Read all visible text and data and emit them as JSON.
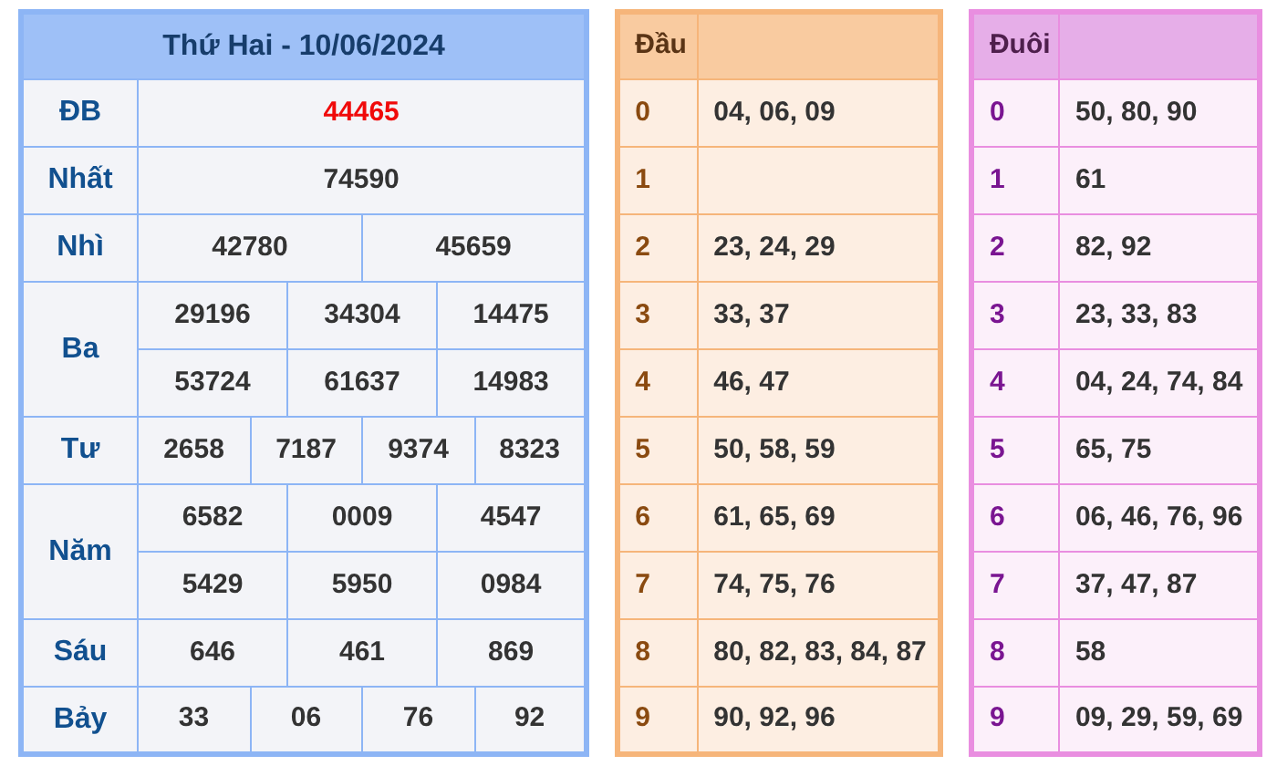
{
  "results": {
    "title": "Thứ Hai - 10/06/2024",
    "prizes": [
      {
        "label": "ĐB",
        "highlight": true,
        "rows": [
          [
            "44465"
          ]
        ]
      },
      {
        "label": "Nhất",
        "highlight": false,
        "rows": [
          [
            "74590"
          ]
        ]
      },
      {
        "label": "Nhì",
        "highlight": false,
        "rows": [
          [
            "42780",
            "45659"
          ]
        ]
      },
      {
        "label": "Ba",
        "highlight": false,
        "rows": [
          [
            "29196",
            "34304",
            "14475"
          ],
          [
            "53724",
            "61637",
            "14983"
          ]
        ]
      },
      {
        "label": "Tư",
        "highlight": false,
        "rows": [
          [
            "2658",
            "7187",
            "9374",
            "8323"
          ]
        ]
      },
      {
        "label": "Năm",
        "highlight": false,
        "rows": [
          [
            "6582",
            "0009",
            "4547"
          ],
          [
            "5429",
            "5950",
            "0984"
          ]
        ]
      },
      {
        "label": "Sáu",
        "highlight": false,
        "rows": [
          [
            "646",
            "461",
            "869"
          ]
        ]
      },
      {
        "label": "Bảy",
        "highlight": false,
        "rows": [
          [
            "33",
            "06",
            "76",
            "92"
          ]
        ]
      }
    ]
  },
  "head_table": {
    "title": "Đầu",
    "rows": [
      {
        "digit": "0",
        "numbers": "04, 06, 09"
      },
      {
        "digit": "1"
      },
      {
        "digit": "2",
        "numbers": "23, 24, 29"
      },
      {
        "digit": "3",
        "numbers": "33, 37"
      },
      {
        "digit": "4",
        "numbers": "46, 47"
      },
      {
        "digit": "5",
        "numbers": "50, 58, 59"
      },
      {
        "digit": "6",
        "numbers": "61, 65, 69"
      },
      {
        "digit": "7",
        "numbers": "74, 75, 76"
      },
      {
        "digit": "8",
        "numbers": "80, 82, 83, 84, 87"
      },
      {
        "digit": "9",
        "numbers": "90, 92, 96"
      }
    ]
  },
  "tail_table": {
    "title": "Đuôi",
    "rows": [
      {
        "digit": "0",
        "numbers": "50, 80, 90"
      },
      {
        "digit": "1",
        "numbers": "61"
      },
      {
        "digit": "2",
        "numbers": "82, 92"
      },
      {
        "digit": "3",
        "numbers": "23, 33, 83"
      },
      {
        "digit": "4",
        "numbers": "04, 24, 74, 84"
      },
      {
        "digit": "5",
        "numbers": "65, 75"
      },
      {
        "digit": "6",
        "numbers": "06, 46, 76, 96"
      },
      {
        "digit": "7",
        "numbers": "37, 47, 87"
      },
      {
        "digit": "8",
        "numbers": "58"
      },
      {
        "digit": "9",
        "numbers": "09, 29, 59, 69"
      }
    ]
  }
}
